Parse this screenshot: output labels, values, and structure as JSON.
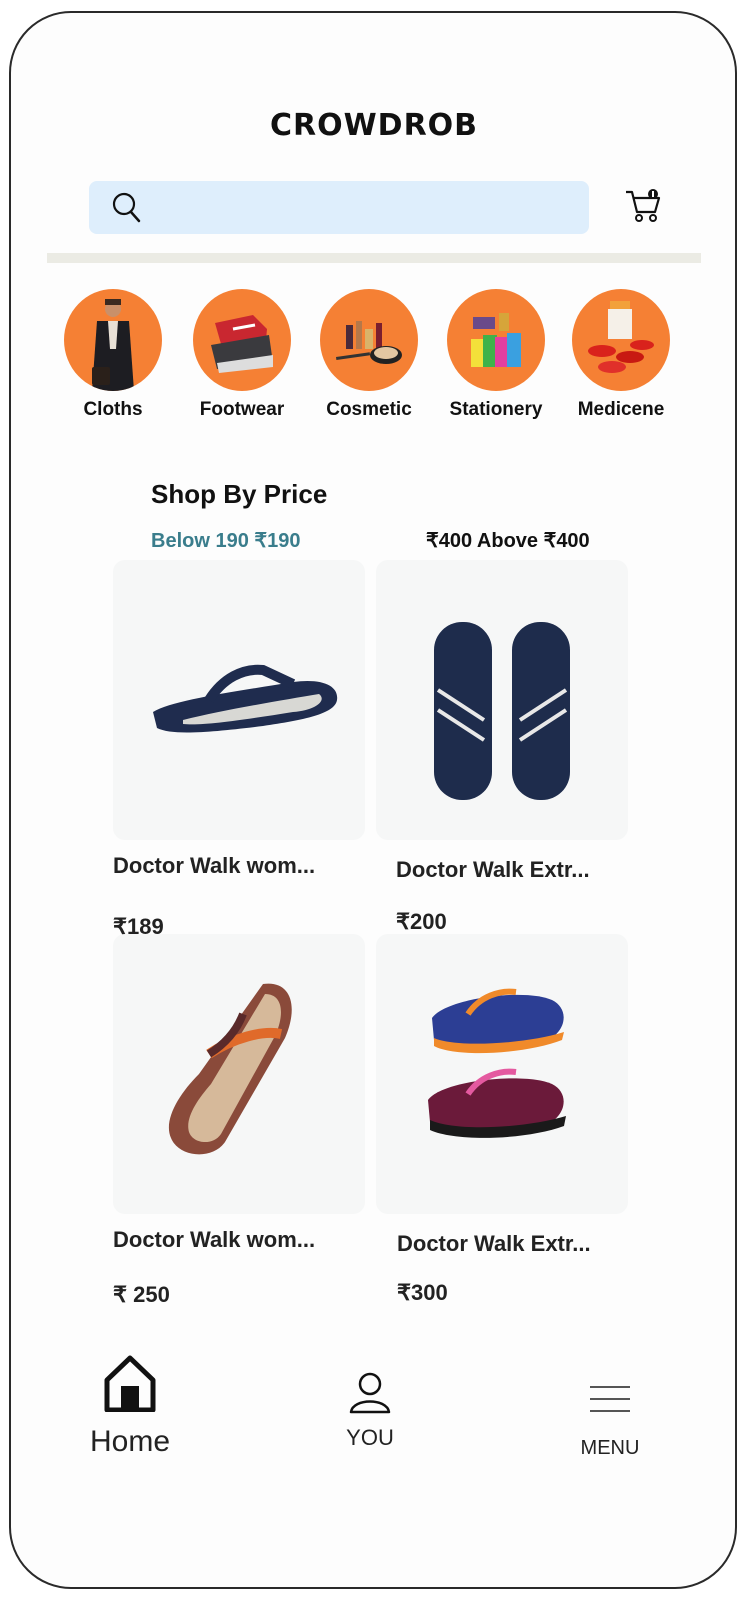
{
  "brand": {
    "logo_text": "CROWDROB"
  },
  "search": {
    "placeholder": ""
  },
  "colors": {
    "accent_orange": "#f58034",
    "search_bg": "#deeefc",
    "price_link": "#3a7d8c"
  },
  "categories": [
    {
      "label": "Cloths",
      "icon": "man-in-coat-image"
    },
    {
      "label": "Footwear",
      "icon": "sneakers-image"
    },
    {
      "label": "Cosmetic",
      "icon": "cosmetics-image"
    },
    {
      "label": "Stationery",
      "icon": "stationery-image"
    },
    {
      "label": "Medicene",
      "icon": "pills-image"
    }
  ],
  "section": {
    "title": "Shop By Price",
    "filters": [
      "Below 190 ₹190",
      "₹400 Above ₹400"
    ]
  },
  "products": [
    {
      "name": "Doctor Walk wom...",
      "price": "₹189",
      "image": "navy-flip-flop-image"
    },
    {
      "name": "Doctor Walk Extr...",
      "price": "₹200",
      "image": "navy-slide-sandals-image"
    },
    {
      "name": "Doctor Walk wom...",
      "price": "₹ 250",
      "image": "brown-flip-flop-image"
    },
    {
      "name": "Doctor Walk Extr...",
      "price": "₹300",
      "image": "blue-and-maroon-flip-flops-image"
    }
  ],
  "bottom_nav": [
    {
      "label": "Home",
      "icon": "home-icon"
    },
    {
      "label": "YOU",
      "icon": "user-icon"
    },
    {
      "label": "MENU",
      "icon": "menu-icon"
    }
  ]
}
